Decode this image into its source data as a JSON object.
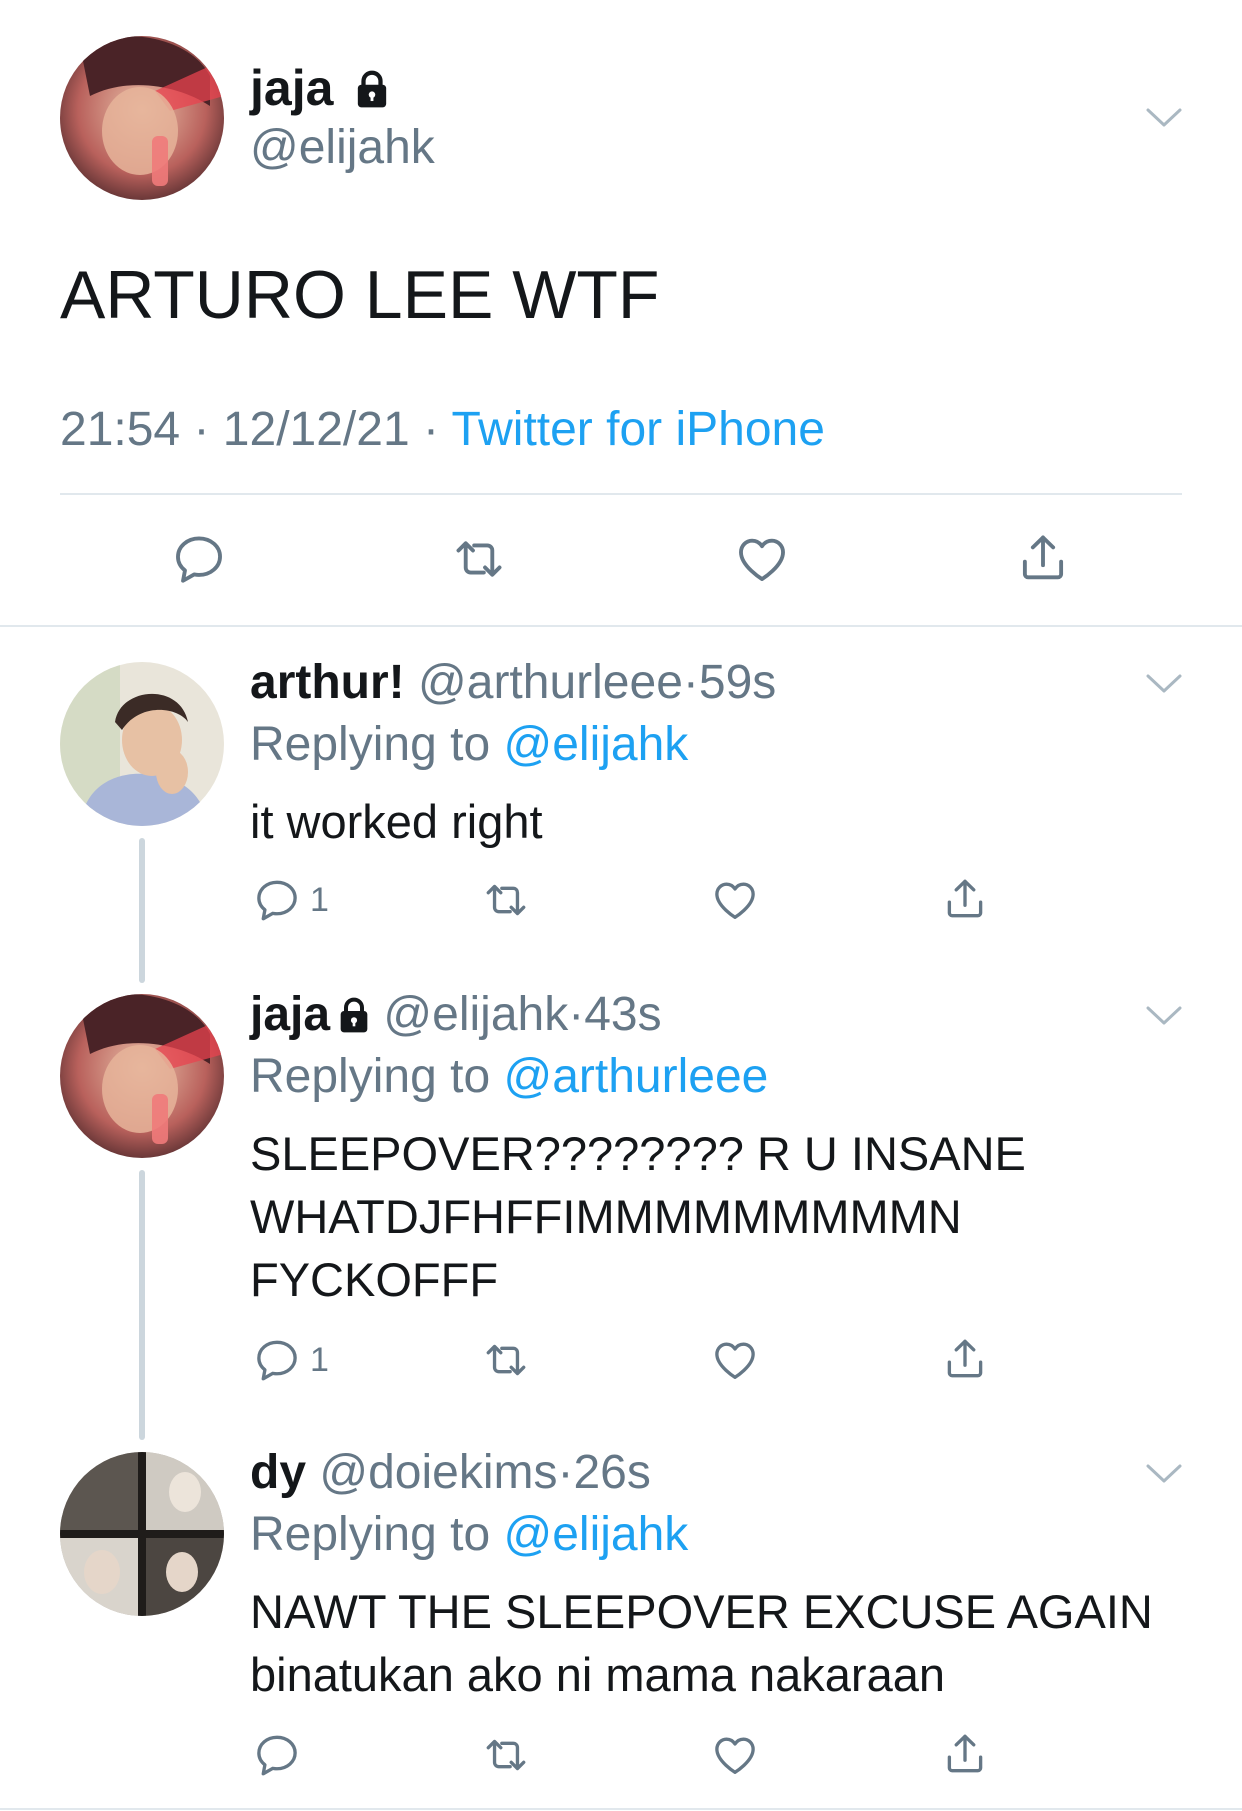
{
  "main_tweet": {
    "name": "jaja",
    "handle": "@elijahk",
    "text": "ARTURO LEE WTF",
    "time": "21:54",
    "date": "12/12/21",
    "source": "Twitter for iPhone",
    "separator": "·"
  },
  "replies": [
    {
      "name": "arthur!",
      "handle": "@arthurleee",
      "time": "59s",
      "replying_prefix": "Replying to",
      "replying_to": "@elijahk",
      "text_lines": [
        "it worked right"
      ],
      "reply_count": "1"
    },
    {
      "name": "jaja",
      "handle": "@elijahk",
      "time": "43s",
      "replying_prefix": "Replying to",
      "replying_to": "@arthurleee",
      "text_lines": [
        "SLEEPOVER???????? R U INSANE",
        "WHATDJFHFFIMMMMMMMMMN",
        "FYCKOFFF"
      ],
      "reply_count": "1"
    },
    {
      "name": "dy",
      "handle": "@doiekims",
      "time": "26s",
      "replying_prefix": "Replying to",
      "replying_to": "@elijahk",
      "text_lines": [
        "NAWT THE SLEEPOVER EXCUSE AGAIN",
        "binatukan ako ni mama nakaraan"
      ],
      "reply_count": ""
    }
  ],
  "icons": {
    "reply": "reply-icon",
    "retweet": "retweet-icon",
    "like": "like-icon",
    "share": "share-icon",
    "lock": "lock-icon",
    "chevron": "chevron-down-icon"
  },
  "colors": {
    "link": "#1da1f2",
    "muted": "#657786",
    "text": "#14171a",
    "divider": "#e1e8ed",
    "thread_line": "#ccd6dd"
  }
}
